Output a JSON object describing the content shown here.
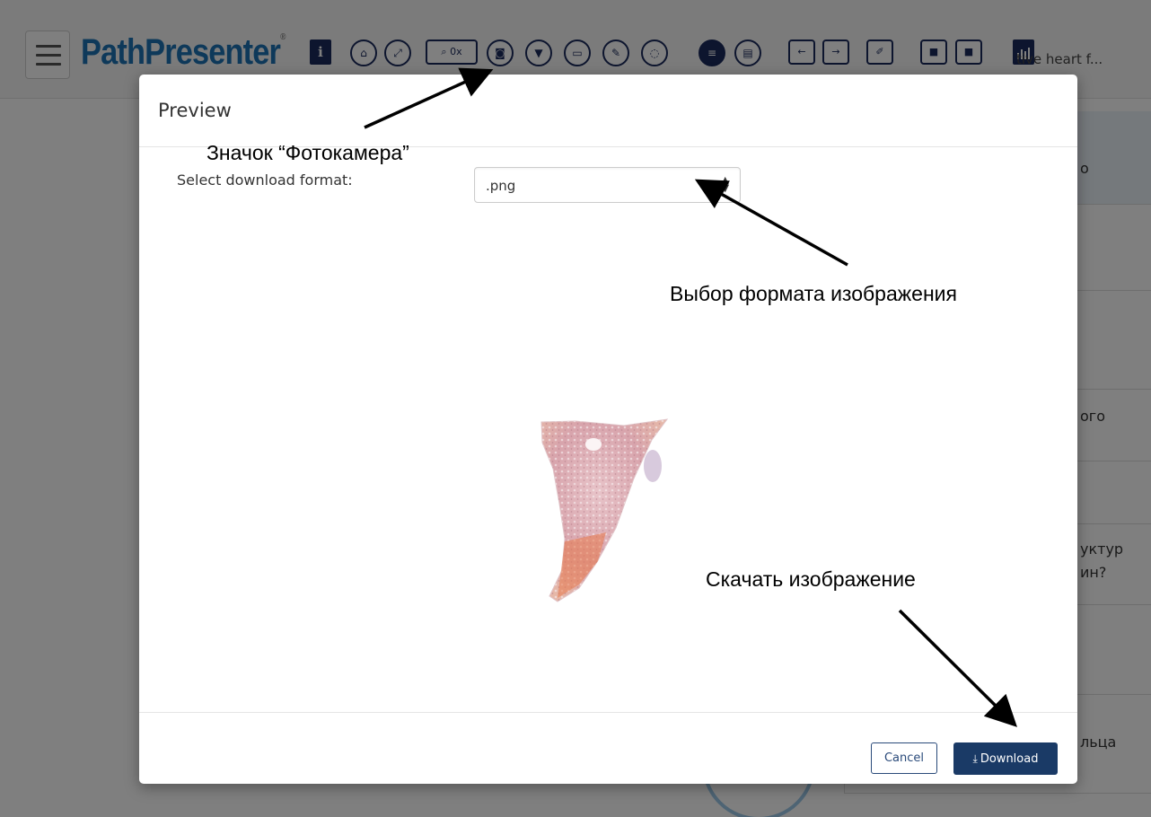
{
  "app": {
    "logo": "PathPresenter",
    "logo_mark": "®",
    "title_truncated": "tive heart f...",
    "toolbar": {
      "info_label": "i",
      "zoom_label": "0x"
    },
    "panel_fragments": [
      "о",
      "ого",
      "уктур",
      "ин?",
      "льца"
    ]
  },
  "modal": {
    "title": "Preview",
    "format_label": "Select download format:",
    "format_value": ".png",
    "cancel_label": "Cancel",
    "download_label": "Download"
  },
  "annotations": {
    "camera": "Значок “Фотокамера”",
    "format": "Выбор формата изображения",
    "download": "Скачать изображение"
  },
  "colors": {
    "brand": "#1d72b4",
    "toolbar_navy": "#1a2a5c",
    "download_button": "#1a3a66"
  }
}
